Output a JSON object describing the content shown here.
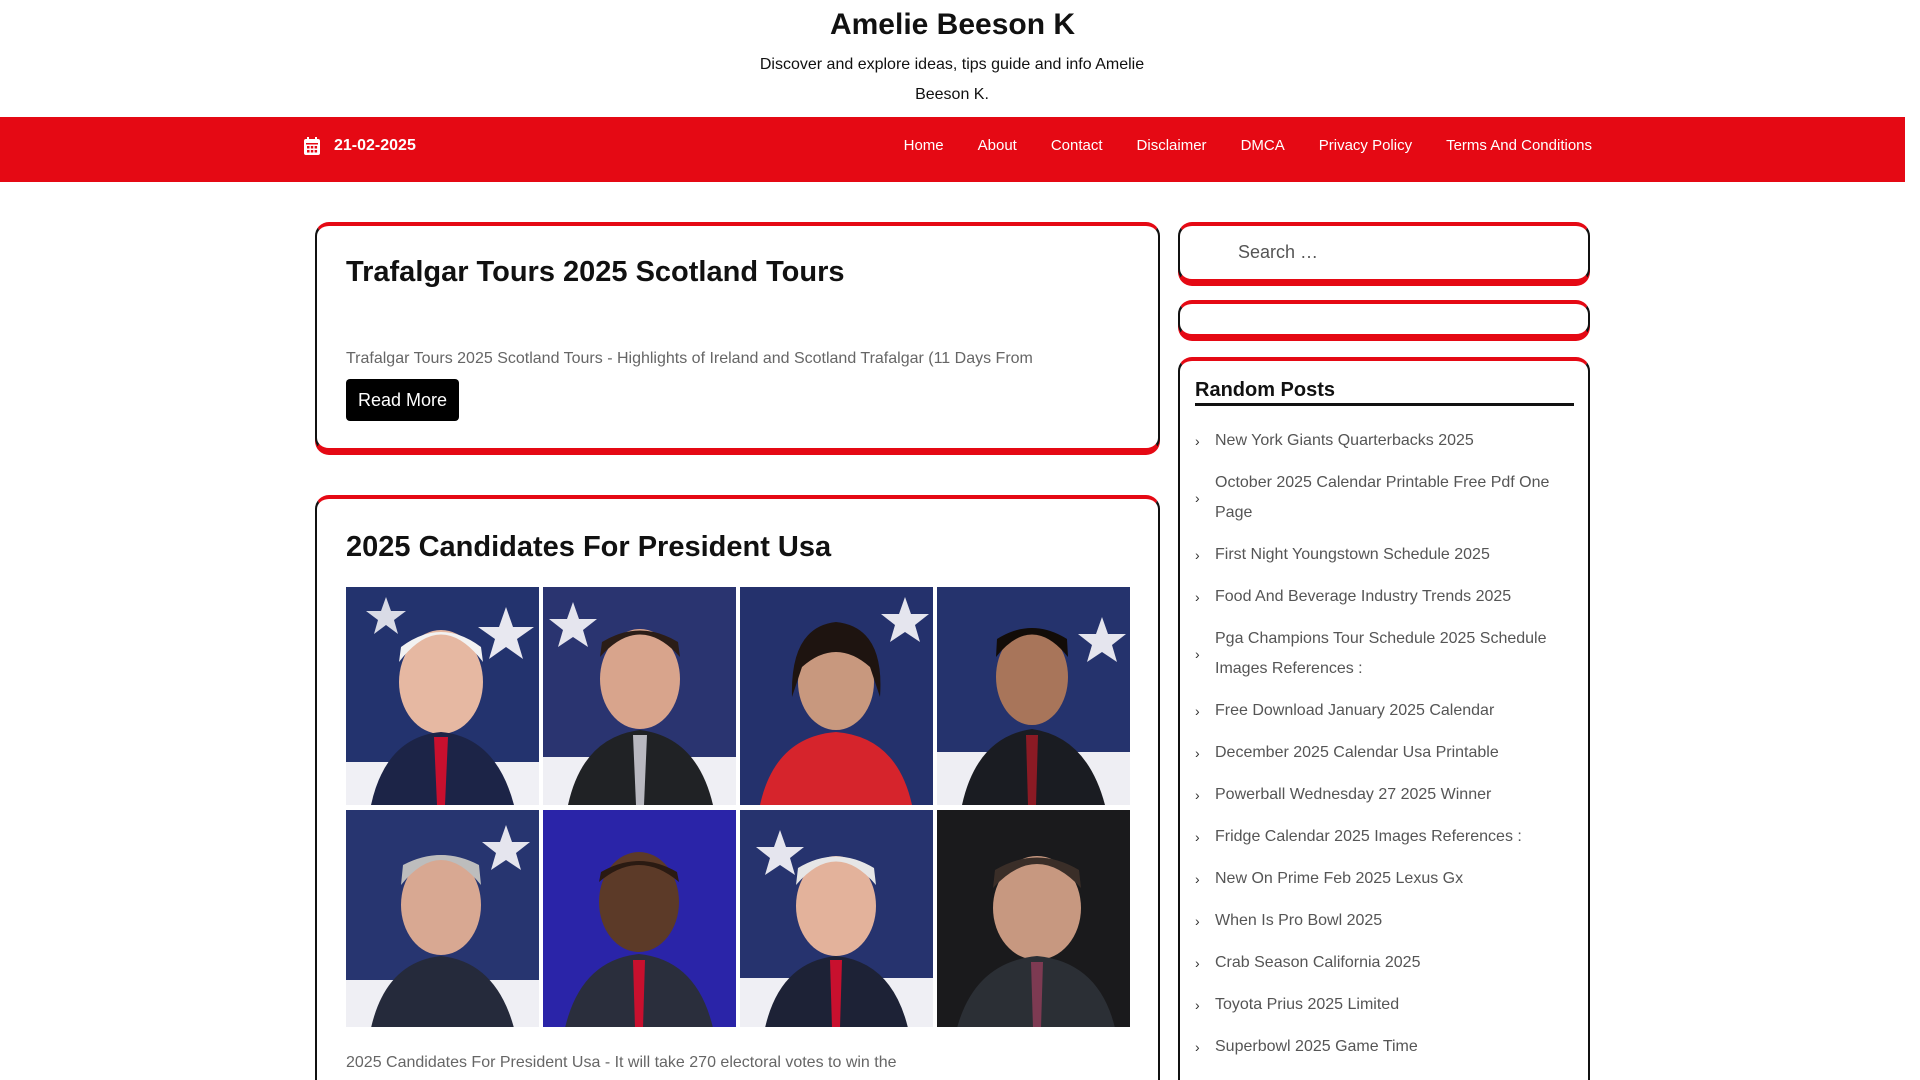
{
  "header": {
    "title": "Amelie Beeson K",
    "tagline": "Discover and explore ideas, tips guide and info Amelie Beeson K."
  },
  "nav": {
    "date": "21-02-2025",
    "items": [
      "Home",
      "About",
      "Contact",
      "Disclaimer",
      "DMCA",
      "Privacy Policy",
      "Terms And Conditions"
    ]
  },
  "posts": [
    {
      "title": "Trafalgar Tours 2025 Scotland Tours",
      "excerpt": "Trafalgar Tours 2025 Scotland Tours - Highlights of Ireland and Scotland Trafalgar (11 Days From",
      "read_more": "Read More"
    },
    {
      "title": "2025 Candidates For President Usa",
      "excerpt": "2025 Candidates For President Usa - It will take 270 electoral votes to win the"
    }
  ],
  "sidebar": {
    "search_placeholder": "Search …",
    "random_posts_title": "Random Posts",
    "random_posts": [
      "New York Giants Quarterbacks 2025",
      "October 2025 Calendar Printable Free Pdf One Page",
      "First Night Youngstown Schedule 2025",
      "Food And Beverage Industry Trends 2025",
      "Pga Champions Tour Schedule 2025 Schedule Images References :",
      "Free Download January 2025 Calendar",
      "December 2025 Calendar Usa Printable",
      "Powerball Wednesday 27 2025 Winner",
      "Fridge Calendar 2025 Images References :",
      "New On Prime Feb 2025 Lexus Gx",
      "When Is Pro Bowl 2025",
      "Crab Season California 2025",
      "Toyota Prius 2025 Limited",
      "Superbowl 2025 Game Time"
    ]
  },
  "colors": {
    "accent": "#e50914",
    "card_border": "#111111"
  },
  "icons": {
    "date": "calendar-icon",
    "list_marker": "chevron-right-icon"
  }
}
